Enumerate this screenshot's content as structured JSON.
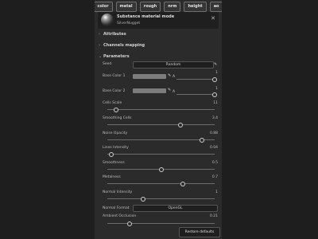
{
  "channels": [
    "color",
    "metal",
    "rough",
    "nrm",
    "height",
    "ao"
  ],
  "material": {
    "title": "Substance material mode",
    "subtitle": "SilverNugget"
  },
  "sections": {
    "attributes": "Attributes",
    "channels_mapping": "Channels mapping",
    "parameters": "Parameters"
  },
  "params": {
    "seed": {
      "label": "Seed",
      "button": "Random"
    },
    "base_color_1": {
      "label": "Base Color 1",
      "alpha_label": "A",
      "value": "1",
      "alpha": 1.0
    },
    "base_color_2": {
      "label": "Base Color 2",
      "alpha_label": "A",
      "value": "1",
      "alpha": 1.0
    },
    "cells_scale": {
      "label": "Cells Scale",
      "value": "11",
      "level": 0.08
    },
    "smoothing_cells": {
      "label": "Smoothing Cells",
      "value": "3.4",
      "level": 0.68
    },
    "noise_opacity": {
      "label": "Noise Opacity",
      "value": "0.88",
      "level": 0.88
    },
    "lines_intensity": {
      "label": "Lines Intensity",
      "value": "0.04",
      "level": 0.04
    },
    "smoothness": {
      "label": "Smoothness",
      "value": "0.5",
      "level": 0.5
    },
    "metalness": {
      "label": "Metalness",
      "value": "0.7",
      "level": 0.7
    },
    "normal_intensity": {
      "label": "Normal Intensity",
      "value": "1",
      "level": 0.33
    },
    "normal_format": {
      "label": "Normal Format",
      "value": "OpenGL"
    },
    "ambient_occlusion": {
      "label": "Ambient Occlusion",
      "value": "0.21",
      "level": 0.21
    }
  },
  "restore_label": "Restore defaults",
  "colors": {
    "background": "#1e1e1e",
    "panel": "#2b2b2b",
    "swatch": "#7c7c7c"
  }
}
